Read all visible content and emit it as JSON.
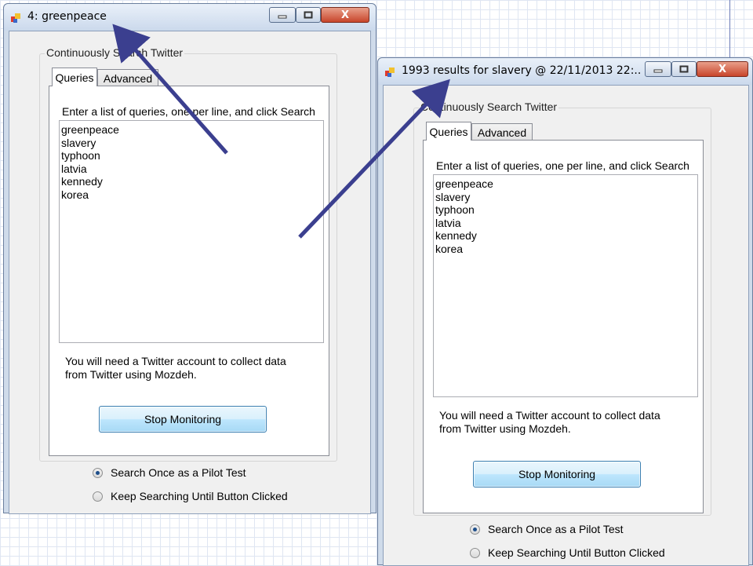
{
  "window1": {
    "title": "4: greenpeace",
    "group_label": "Continuously Search Twitter",
    "tabs": [
      {
        "label": "Queries",
        "active": true
      },
      {
        "label": "Advanced",
        "active": false
      }
    ],
    "instruction": "Enter a list of queries, one per line, and click Search",
    "queries": [
      "greenpeace",
      "slavery",
      "typhoon",
      "latvia",
      "kennedy",
      "korea"
    ],
    "note_line1": "You will need a Twitter account to collect data",
    "note_line2": "from Twitter using Mozdeh.",
    "button_label": "Stop Monitoring",
    "radios": [
      {
        "label": "Search Once as a Pilot Test",
        "checked": true
      },
      {
        "label": "Keep Searching Until Button Clicked",
        "checked": false
      }
    ]
  },
  "window2": {
    "title": "1993 results for slavery @  22/11/2013 22:...",
    "group_label": "Continuously Search Twitter",
    "tabs": [
      {
        "label": "Queries",
        "active": true
      },
      {
        "label": "Advanced",
        "active": false
      }
    ],
    "instruction": "Enter a list of queries, one per line, and click Search",
    "queries": [
      "greenpeace",
      "slavery",
      "typhoon",
      "latvia",
      "kennedy",
      "korea"
    ],
    "note_line1": "You will need a Twitter account to collect data",
    "note_line2": "from Twitter using Mozdeh.",
    "button_label": "Stop Monitoring",
    "radios": [
      {
        "label": "Search Once as a Pilot Test",
        "checked": true
      },
      {
        "label": "Keep Searching Until Button Clicked",
        "checked": false
      }
    ]
  },
  "window_controls": {
    "minimize": "—",
    "maximize": "☐",
    "close": "X"
  },
  "colors": {
    "arrow": "#3b3f8f",
    "title_bar": "#cbd9ec",
    "close_button": "#c8452b",
    "button_border": "#3c7fb1"
  }
}
